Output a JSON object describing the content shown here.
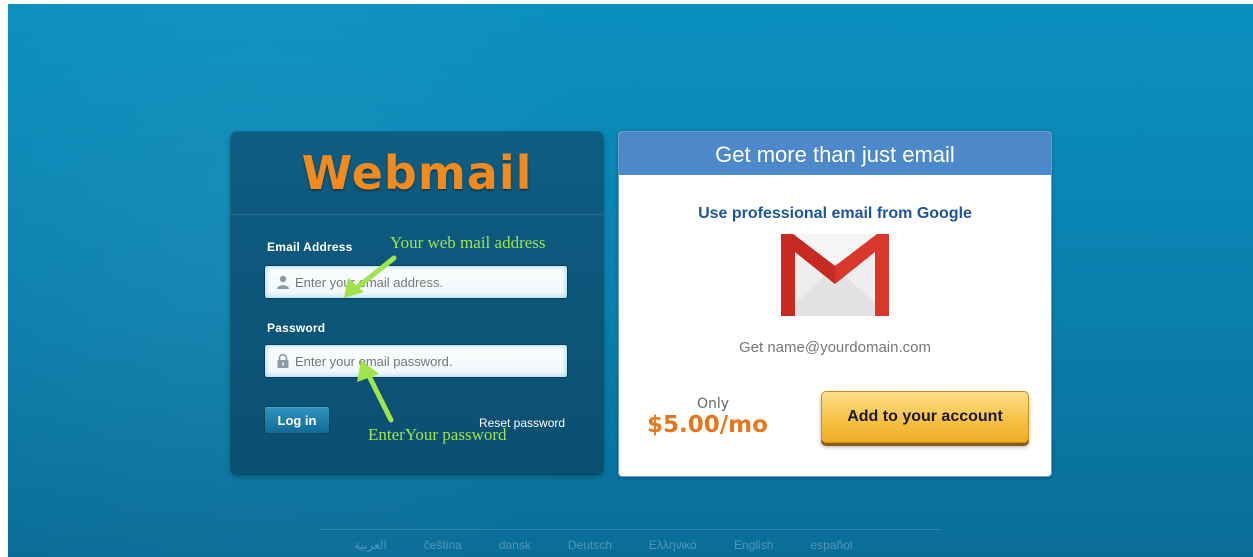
{
  "login": {
    "logo": "Webmail",
    "email_label": "Email Address",
    "email_placeholder": "Enter your email address.",
    "password_label": "Password",
    "password_placeholder": "Enter your email password.",
    "login_button": "Log in",
    "reset_link": "Reset password"
  },
  "annotations": {
    "email_hint": "Your web mail address",
    "password_hint": "EnterYour password",
    "arrow_color": "#9fe44d"
  },
  "promo": {
    "header": "Get more than just email",
    "title": "Use professional email from Google",
    "domain_text": "Get name@yourdomain.com",
    "price_prefix": "Only",
    "price": "$5.00/mo",
    "add_button": "Add to your account",
    "icon": "gmail-logo"
  },
  "languages": [
    "العربية",
    "čeština",
    "dansk",
    "Deutsch",
    "Ελληνικά",
    "English",
    "español"
  ],
  "colors": {
    "background": "#0a84b2",
    "logo": "#f28a1e",
    "promo_header": "#4d88cb",
    "price": "#e8761c",
    "add_button": "#f6c248"
  }
}
